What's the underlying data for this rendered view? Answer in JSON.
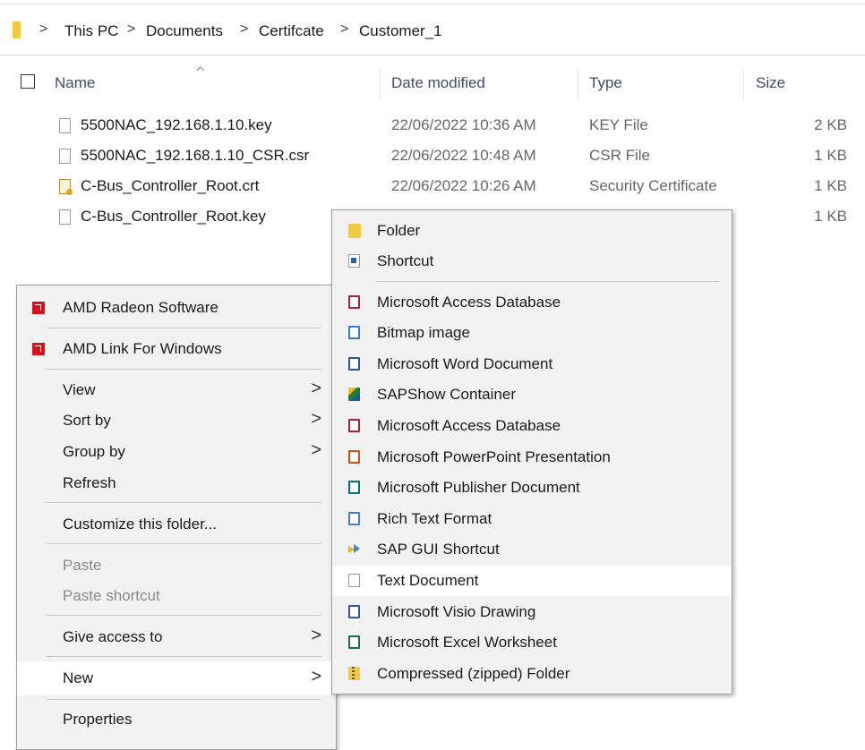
{
  "breadcrumb": {
    "items": [
      "This PC",
      "Documents",
      "Certifcate",
      "Customer_1"
    ],
    "separator": ">"
  },
  "columns": {
    "name": "Name",
    "date": "Date modified",
    "type": "Type",
    "size": "Size"
  },
  "files": [
    {
      "name": "5500NAC_192.168.1.10.key",
      "date": "22/06/2022 10:36 AM",
      "type": "KEY File",
      "size": "2 KB",
      "icon": "file-icon"
    },
    {
      "name": "5500NAC_192.168.1.10_CSR.csr",
      "date": "22/06/2022 10:48 AM",
      "type": "CSR File",
      "size": "1 KB",
      "icon": "file-icon"
    },
    {
      "name": "C-Bus_Controller_Root.crt",
      "date": "22/06/2022 10:26 AM",
      "type": "Security Certificate",
      "size": "1 KB",
      "icon": "certificate-icon"
    },
    {
      "name": "C-Bus_Controller_Root.key",
      "date": "",
      "type": "",
      "size": "1 KB",
      "icon": "file-icon"
    }
  ],
  "context_menu": {
    "amd_radeon": "AMD Radeon Software",
    "amd_link": "AMD Link For Windows",
    "view": "View",
    "sort_by": "Sort by",
    "group_by": "Group by",
    "refresh": "Refresh",
    "customize": "Customize this folder...",
    "paste": "Paste",
    "paste_shortcut": "Paste shortcut",
    "give_access": "Give access to",
    "new": "New",
    "properties": "Properties",
    "submenu_arrow": ">"
  },
  "new_submenu": {
    "folder": "Folder",
    "shortcut": "Shortcut",
    "access_db_1": "Microsoft Access Database",
    "bitmap": "Bitmap image",
    "word": "Microsoft Word Document",
    "sapshow": "SAPShow Container",
    "access_db_2": "Microsoft Access Database",
    "powerpoint": "Microsoft PowerPoint Presentation",
    "publisher": "Microsoft Publisher Document",
    "rtf": "Rich Text Format",
    "sap_gui": "SAP GUI Shortcut",
    "text_doc": "Text Document",
    "visio": "Microsoft Visio Drawing",
    "excel": "Microsoft Excel Worksheet",
    "zip": "Compressed (zipped) Folder"
  },
  "colors": {
    "header_text": "#3d4d66",
    "menu_bg": "#f2f2f2",
    "highlight": "#ffffff",
    "amd_red": "#d4141c",
    "folder_yellow": "#f3c93f"
  }
}
